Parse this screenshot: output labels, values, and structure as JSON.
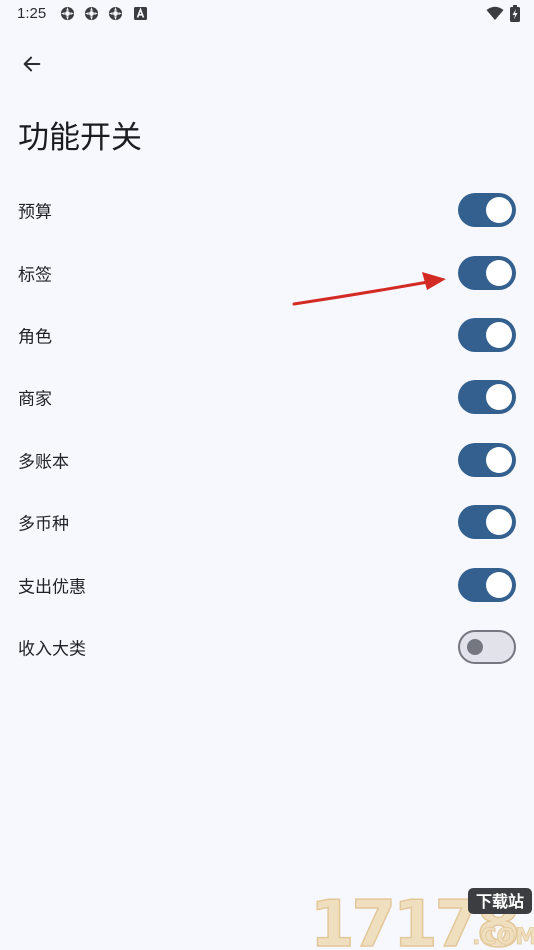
{
  "status_bar": {
    "time": "1:25",
    "notification_icons": [
      "settings-gear-icon",
      "settings-gear-icon",
      "settings-gear-icon",
      "a-badge-icon"
    ],
    "system_icons": [
      "wifi-icon",
      "battery-charging-icon"
    ]
  },
  "header": {
    "back_icon": "arrow-left-icon",
    "title": "功能开关"
  },
  "settings": [
    {
      "label": "预算",
      "on": true
    },
    {
      "label": "标签",
      "on": true
    },
    {
      "label": "角色",
      "on": true
    },
    {
      "label": "商家",
      "on": true
    },
    {
      "label": "多账本",
      "on": true
    },
    {
      "label": "多币种",
      "on": true
    },
    {
      "label": "支出优惠",
      "on": true
    },
    {
      "label": "收入大类",
      "on": false
    }
  ],
  "watermark": {
    "logo_text": "17178",
    "badge_text": "下载站",
    "domain_text": ".COM"
  },
  "colors": {
    "background": "#f7f8fd",
    "switch_on": "#33608e",
    "switch_off_track": "#e1e2ea",
    "switch_off_outline": "#74777f",
    "annotation_arrow": "#d42a24"
  }
}
